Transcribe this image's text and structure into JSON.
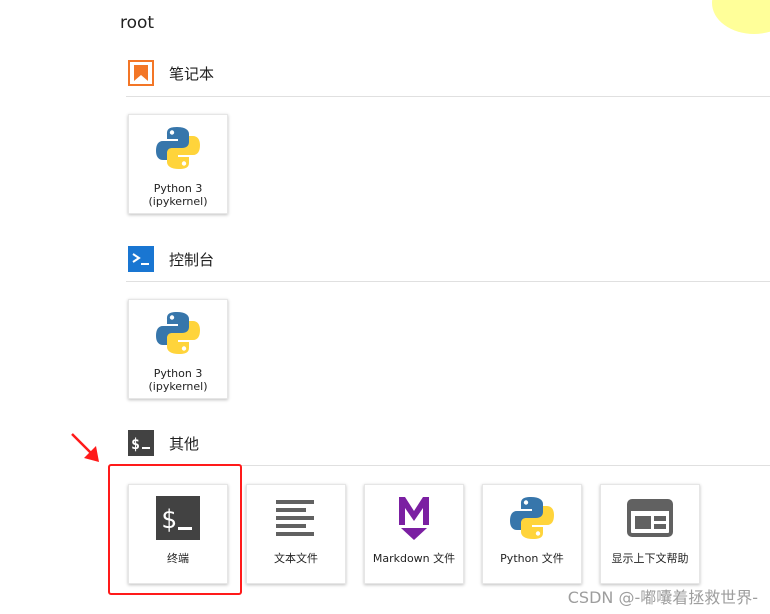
{
  "directory": {
    "title": "root"
  },
  "sections": {
    "notebook": {
      "label": "笔记本",
      "icon": "bookmark-icon",
      "accent": "#f37626",
      "cards": [
        {
          "label": "Python 3\n(ipykernel)",
          "icon": "python-logo-icon"
        }
      ]
    },
    "console": {
      "label": "控制台",
      "icon": "console-prompt-icon",
      "accent": "#1976d2",
      "cards": [
        {
          "label": "Python 3\n(ipykernel)",
          "icon": "python-logo-icon"
        }
      ]
    },
    "other": {
      "label": "其他",
      "icon": "terminal-icon",
      "accent": "#424242",
      "cards": [
        {
          "label": "终端",
          "icon": "terminal-icon"
        },
        {
          "label": "文本文件",
          "icon": "text-file-icon"
        },
        {
          "label": "Markdown 文件",
          "icon": "markdown-icon"
        },
        {
          "label": "Python 文件",
          "icon": "python-logo-icon"
        },
        {
          "label": "显示上下文帮助",
          "icon": "context-help-icon"
        }
      ]
    }
  },
  "annotation": {
    "highlight_color": "#ff1a1a"
  },
  "watermark": {
    "text": "CSDN @-嘟囔着拯救世界-"
  }
}
